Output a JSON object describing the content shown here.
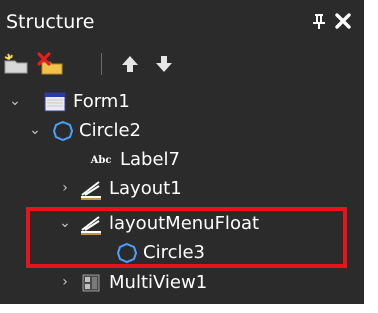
{
  "panel": {
    "title": "Structure",
    "pin_glyph": "ᨡ",
    "close_glyph": "✖"
  },
  "toolbar": {
    "items": [
      {
        "name": "add-component-icon"
      },
      {
        "name": "delete-component-icon"
      },
      {
        "name": "move-up-icon"
      },
      {
        "name": "move-down-icon"
      }
    ]
  },
  "tree": {
    "nodes": [
      {
        "label": "Form1",
        "icon": "form-icon",
        "expander": "expanded",
        "level": 0
      },
      {
        "label": "Circle2",
        "icon": "circle-icon",
        "expander": "expanded",
        "level": 1
      },
      {
        "label": "Label7",
        "icon": "label-icon",
        "icon_text": "Abc",
        "expander": "none",
        "level": 2
      },
      {
        "label": "Layout1",
        "icon": "layout-icon",
        "expander": "collapsed",
        "level": 1
      },
      {
        "label": "layoutMenuFloat",
        "icon": "layout-icon",
        "expander": "expanded",
        "level": 1
      },
      {
        "label": "Circle3",
        "icon": "circle-icon",
        "expander": "none",
        "level": 2
      },
      {
        "label": "MultiView1",
        "icon": "multiview-icon",
        "expander": "collapsed",
        "level": 1
      }
    ]
  },
  "colors": {
    "panel_background": "#2b2b2b",
    "highlight_border": "#e8141c",
    "text": "#ffffff"
  }
}
